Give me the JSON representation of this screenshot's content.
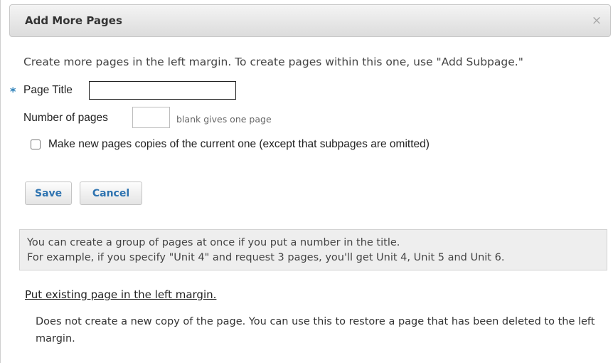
{
  "dialog": {
    "title": "Add More Pages",
    "close_glyph": "×",
    "close_icon": "close-icon"
  },
  "intro_text": "Create more pages in the left margin. To create pages within this one, use \"Add Subpage.\"",
  "form": {
    "required_marker": "*",
    "page_title_label": "Page Title",
    "page_title_value": "",
    "number_label": "Number of pages",
    "number_value": "",
    "number_hint": "blank gives one page",
    "copy_checkbox_checked": false,
    "copy_checkbox_label": "Make new pages copies of the current one (except that subpages are omitted)"
  },
  "buttons": {
    "save": "Save",
    "cancel": "Cancel"
  },
  "note": {
    "line1": "You can create a group of pages at once if you put a number in the title.",
    "line2": "For example, if you specify \"Unit 4\" and request 3 pages, you'll get Unit 4, Unit 5 and Unit 6."
  },
  "existing": {
    "link": "Put existing page in the left margin.",
    "description": "Does not create a new copy of the page. You can use this to restore a page that has been deleted to the left margin."
  },
  "colors": {
    "accent": "#2e73b0",
    "required_marker": "#2c80b9",
    "note_background": "#eeeeee"
  }
}
